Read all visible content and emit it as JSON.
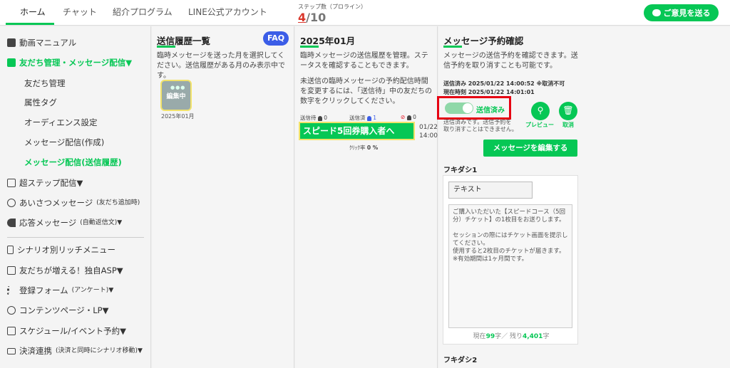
{
  "nav_tabs": [
    "ホーム",
    "チャット",
    "紹介プログラム",
    "LINE公式アカウント"
  ],
  "step": {
    "label": "ステップ数（プロライン）",
    "current": "4",
    "total": "/10"
  },
  "feedback_label": "ご意見を送る",
  "sidebar": {
    "video_manual": "動画マニュアル",
    "friends_mgmt": "友だち管理・メッセージ配信▼",
    "sub": [
      "友だち管理",
      "属性タグ",
      "オーディエンス設定",
      "メッセージ配信(作成)",
      "メッセージ配信(送信履歴)"
    ],
    "super_step": "超ステップ配信▼",
    "greeting": "あいさつメッセージ",
    "greeting_note": "(友だち追加時)",
    "response": "応答メッセージ",
    "response_note": "(自動返信文)▼",
    "scenario_menu": "シナリオ別リッチメニュー",
    "asp": "友だちが増える！独自ASP▼",
    "form": "登録フォーム",
    "form_note": "(アンケート)▼",
    "contents": "コンテンツページ・LP▼",
    "schedule": "スケジュール/イベント予約▼",
    "payment": "決済連携",
    "payment_note": "(決済と同時にシナリオ移動)▼"
  },
  "history_panel": {
    "title": "送信履歴一覧",
    "faq": "FAQ",
    "desc": "臨時メッセージを送った月を選択してください。送信履歴がある月のみ表示中です。",
    "thumb_badge": "編集中",
    "month": "2025年01月"
  },
  "month_panel": {
    "title": "2025年01月",
    "desc1": "臨時メッセージの送信履歴を管理。ステータスを確認することもできます。",
    "desc2": "未送信の臨時メッセージの予約配信時間を変更するには、「送信待」中の友だちの数字をクリックしてください。",
    "wait_label": "送信待",
    "wait_count": "0",
    "sent_label": "送信済",
    "sent_count": "1",
    "block_count": "0",
    "message_name": "スピード5回券購入者へ",
    "date": "01/22",
    "time": "14:00",
    "click_label": "ｸﾘｯｸ率",
    "click_value": "0 %"
  },
  "confirm_panel": {
    "title": "メッセージ予約確認",
    "desc": "メッセージの送信予約を確認できます。送信予約を取り消すことも可能です。",
    "sent_line": "送信済み 2025/01/22 14:00:52 ※取消不可",
    "now_line": "現在時刻 2025/01/22 14:01:01",
    "toggle_label": "送信済み",
    "preview_label": "プレビュー",
    "cancel_label": "取消",
    "note": "送信済みです。送信予約を\n取り消すことはできません。",
    "edit_label": "メッセージを編集する",
    "bubble1": "フキダシ1",
    "type_label": "テキスト",
    "message_text": "ご購入いただいた【スピードコース（5回分）チケット】の1枚目をお送りします。\n\nセッションの際にはチケット画面を提示してください。\n使用すると2枚目のチケットが届きます。\n※有効期間は1ヶ月間です。",
    "counter_now": "現在",
    "counter_used": "99",
    "counter_mid": "字／ 残り",
    "counter_left": "4,401",
    "counter_end": "字",
    "bubble2": "フキダシ2"
  },
  "colors": {
    "accent": "#06c755",
    "highlight": "#e60012",
    "faq": "#3b5de7"
  }
}
